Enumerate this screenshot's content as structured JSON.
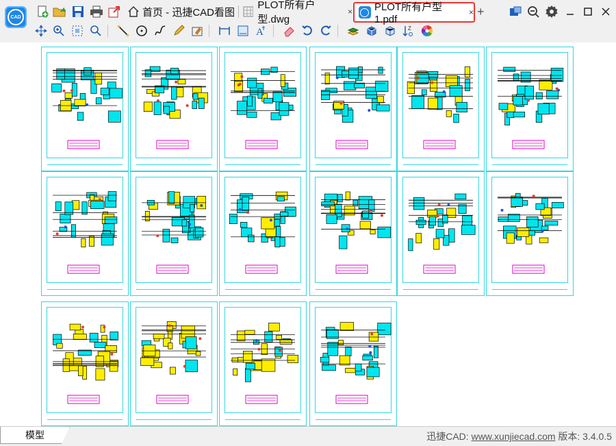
{
  "app": {
    "logo_text": "CAD"
  },
  "tabs": [
    {
      "label": "首页 - 迅捷CAD看图"
    },
    {
      "label": "PLOT所有户型.dwg"
    },
    {
      "label": "PLOT所有户型1.pdf"
    }
  ],
  "tab_close": "×",
  "new_tab": "+",
  "statusbar": {
    "model_tab": "模型",
    "brand_prefix": "迅捷CAD: ",
    "website": "www.xunjiecad.com",
    "version_label": " 版本: 3.4.0.5"
  },
  "colors": {
    "accent": "#1e88e5",
    "sheet_border": "#33d6e0",
    "highlight": "#e53935"
  }
}
